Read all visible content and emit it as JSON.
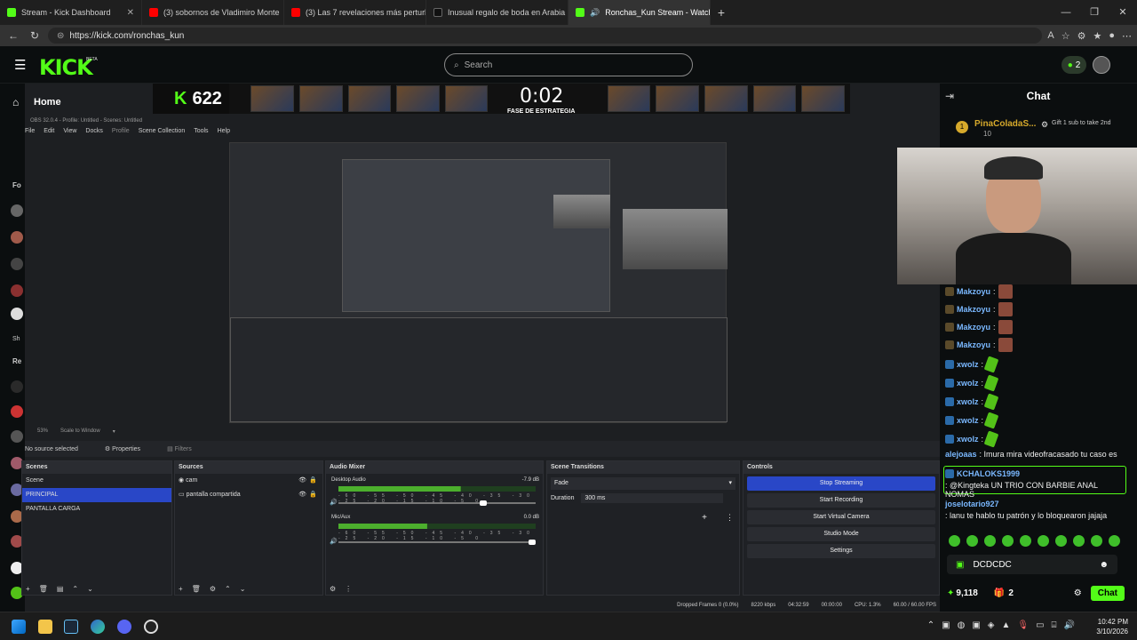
{
  "browser": {
    "tabs": [
      {
        "label": "Stream - Kick Dashboard",
        "color": "#53fc18"
      },
      {
        "label": "(3) sobornos de Vladimiro Monte",
        "color": "#ff0000"
      },
      {
        "label": "(3) Las 7 revelaciones más perturb",
        "color": "#ff0000"
      },
      {
        "label": "Inusual regalo de boda en Arabia",
        "color": "#000000"
      },
      {
        "label": "Ronchas_Kun Stream - Watch",
        "color": "#53fc18"
      }
    ],
    "new_tab": "+",
    "url": "https://kick.com/ronchas_kun"
  },
  "kick": {
    "logo": "KICK",
    "beta": "BETA",
    "search_placeholder": "Search",
    "notif_count": "2",
    "sidebar_home": "Home",
    "sidebar_fo": "Fo",
    "sidebar_sh": "Sh",
    "sidebar_re": "Re"
  },
  "game_overlay": {
    "kill_count": "622",
    "timer": "0:02",
    "phase": "FASE DE ESTRATEGIA"
  },
  "obs": {
    "title": "OBS 32.0.4 - Profile: Untitled - Scenes: Untitled",
    "menu": [
      "File",
      "Edit",
      "View",
      "Docks",
      "Profile",
      "Scene Collection",
      "Tools",
      "Help"
    ],
    "zoom": "53%",
    "scale": "Scale to Window",
    "no_source": "No source selected",
    "properties": "Properties",
    "filters": "Filters",
    "scenes_title": "Scenes",
    "scenes": [
      "Scene",
      "PRINCIPAL",
      "PANTALLA CARGA"
    ],
    "selected_scene": 1,
    "sources_title": "Sources",
    "sources": [
      "cam",
      "pantalla compartida"
    ],
    "mixer_title": "Audio Mixer",
    "desktop_audio": "Desktop Audio",
    "desktop_db": "-7.9 dB",
    "mic": "Mic/Aux",
    "mic_db": "0.0 dB",
    "scale_ticks": "-60 -55 -50 -45 -40 -35 -30 -25 -20 -15 -10 -5 0",
    "desktop_level": 0.62,
    "desktop_volume": 0.75,
    "mic_level": 0.45,
    "mic_volume": 1.0,
    "transitions_title": "Scene Transitions",
    "transition": "Fade",
    "duration_label": "Duration",
    "duration": "300 ms",
    "controls_title": "Controls",
    "controls": [
      "Stop Streaming",
      "Start Recording",
      "Start Virtual Camera",
      "Studio Mode",
      "Settings"
    ],
    "status": {
      "dropped": "Dropped Frames 0 (0.0%)",
      "kbps": "8220 kbps",
      "stream_time": "04:32:59",
      "rec_time": "00:00:00",
      "cpu": "CPU: 1.3%",
      "fps": "60.00 / 60.00 FPS"
    }
  },
  "chat": {
    "title": "Chat",
    "pinned_user": "PinaColadaS...",
    "pinned_count": "10",
    "gift_text": "Gift 1 sub to take 2nd",
    "messages": [
      {
        "user": "Makzoyu",
        "text": ":"
      },
      {
        "user": "Makzoyu",
        "text": ":"
      },
      {
        "user": "Makzoyu",
        "text": ":"
      },
      {
        "user": "Makzoyu",
        "text": ":"
      },
      {
        "user": "xwolz",
        "text": ":"
      },
      {
        "user": "xwolz",
        "text": ":"
      },
      {
        "user": "xwolz",
        "text": ":"
      },
      {
        "user": "xwolz",
        "text": ":"
      },
      {
        "user": "xwolz",
        "text": ":"
      },
      {
        "user": "alejoaas",
        "text": ": Imura mira videofracasado tu caso es"
      },
      {
        "user": "KCHALOKS1999",
        "text": ": @Kingteka UN TRIO CON BARBIE ANAL NOMAS"
      },
      {
        "user": "joselotario927",
        "text": ": lanu te hablo tu patrón y lo bloquearon jajaja"
      }
    ],
    "input_value": "DCDCDC",
    "points": "9,118",
    "gift_count": "2",
    "send": "Chat"
  },
  "taskbar": {
    "time": "10:42 PM",
    "date": "3/10/2026"
  }
}
